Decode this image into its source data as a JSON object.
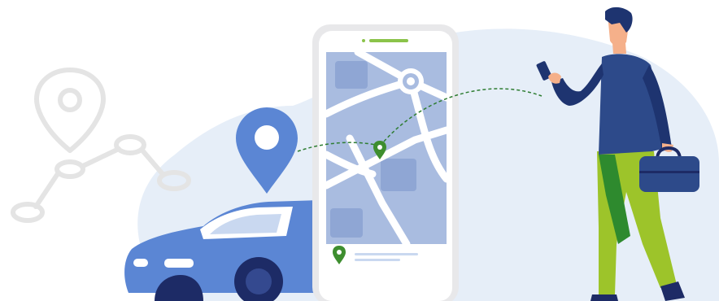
{
  "illustration": {
    "subject": "ride-hailing",
    "colors": {
      "background_blob": "#E6EEF8",
      "route_outline": "#E4E4E4",
      "pin_blue": "#5B86D4",
      "car_body": "#5B86D4",
      "car_dark": "#1D2B66",
      "phone_frame": "#E8E8EA",
      "map_base": "#A9BCE0",
      "map_road": "#FFFFFF",
      "map_pin_green": "#3E8E2F",
      "status_green": "#8BC34A",
      "jacket": "#2D4A8A",
      "pants_lime": "#9DC42A",
      "pants_shadow": "#2E8A2E",
      "hair": "#1E3470",
      "skin": "#F5B08A",
      "bag": "#2D4A8A",
      "dashed_path": "#2E7D32"
    },
    "icons": [
      "map-pin-icon",
      "location-pin-icon",
      "route-icon",
      "car-icon",
      "smartphone-icon",
      "briefcase-icon"
    ]
  }
}
